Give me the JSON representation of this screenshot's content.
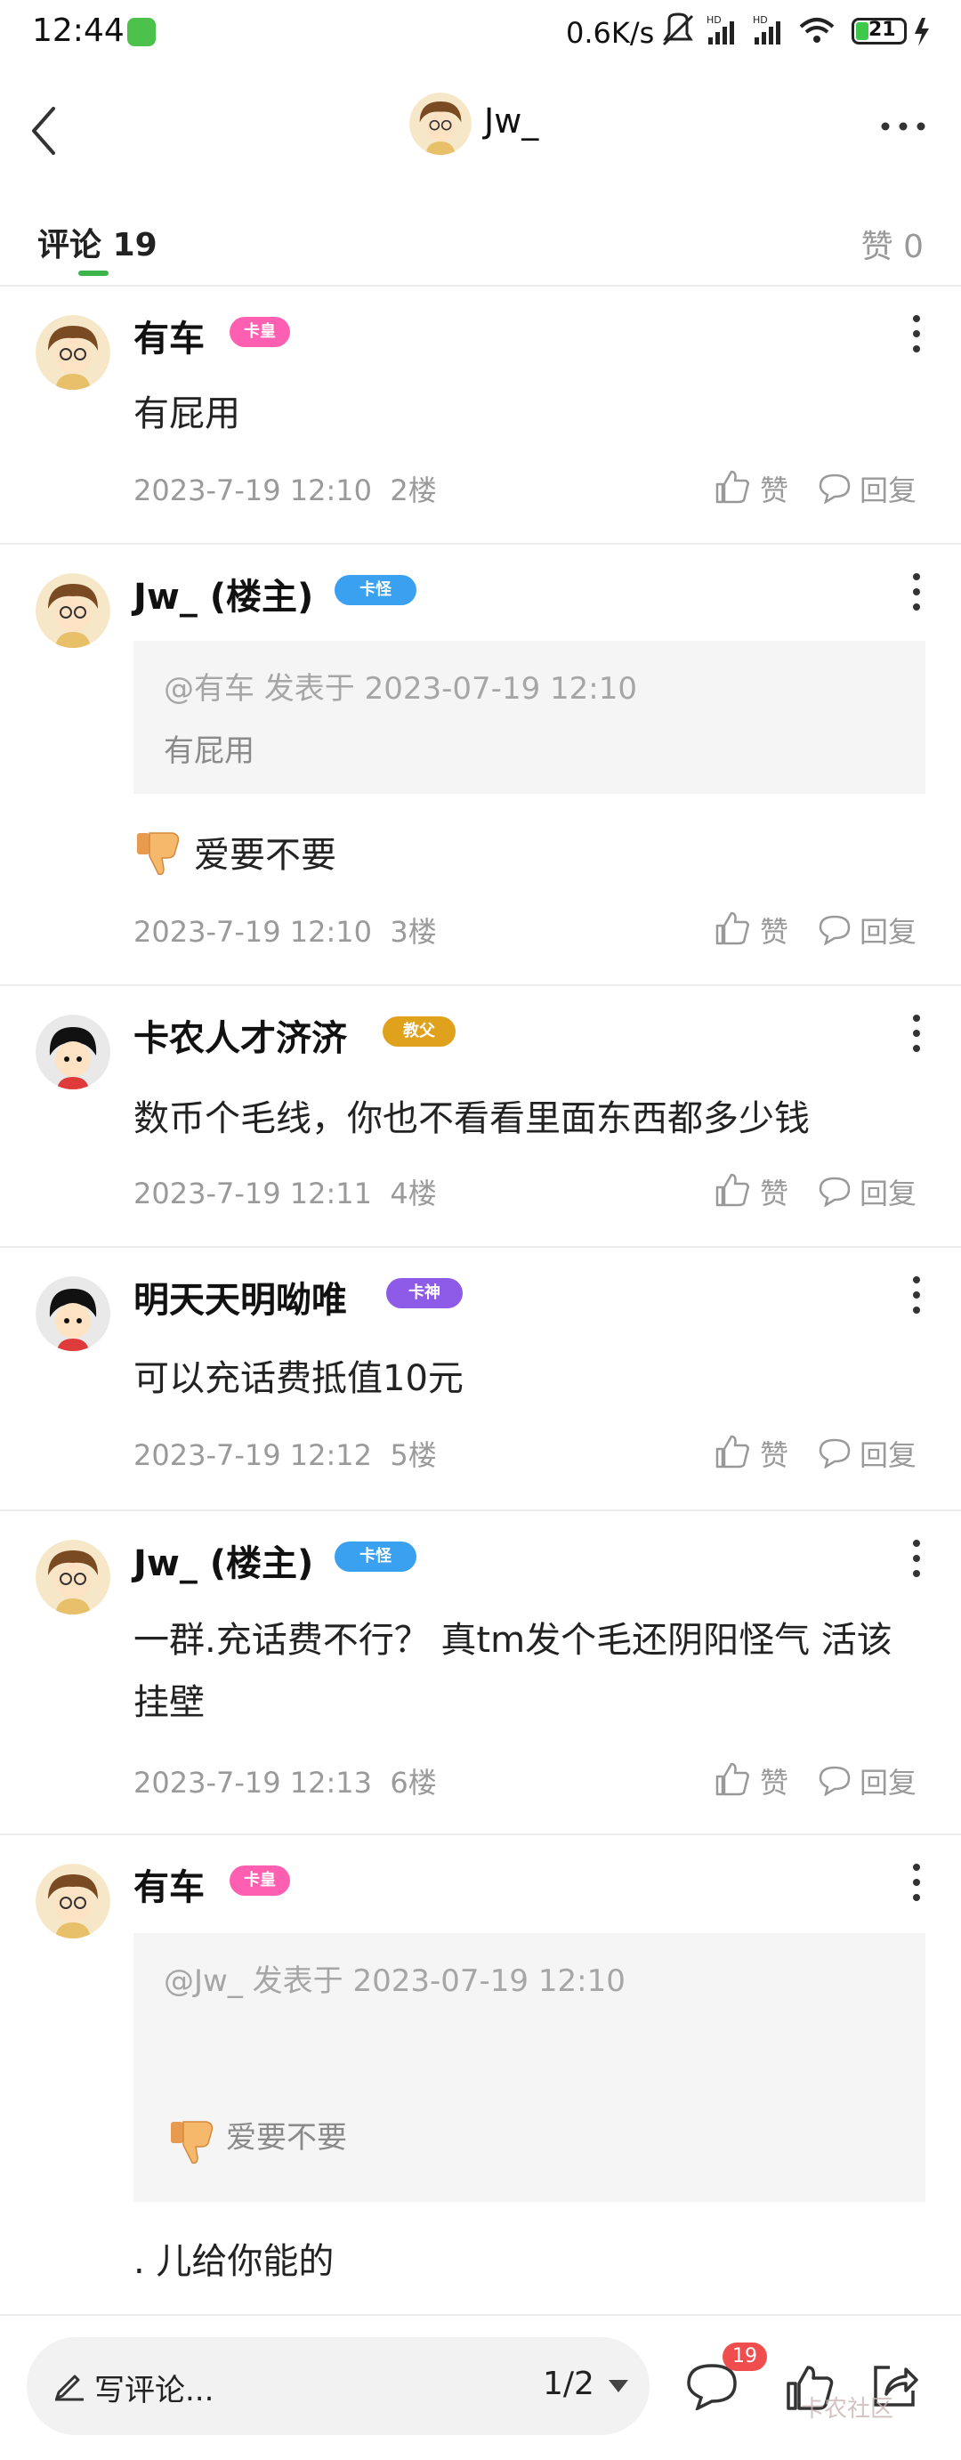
{
  "status_bar": {
    "time": "12:44",
    "speed": "0.6K/s",
    "battery": "21"
  },
  "header": {
    "title": "Jw_"
  },
  "tabs": {
    "comments_label": "评论",
    "comments_count": "19",
    "likes_label": "赞",
    "likes_count": "0"
  },
  "comments": [
    {
      "name": "有车",
      "badge": "卡皇",
      "badge_color": "#ff5fb0",
      "text": "有屁用",
      "time": "2023-7-19 12:10",
      "floor": "2楼"
    },
    {
      "name": "Jw_ (楼主)",
      "badge": "卡怪",
      "badge_color": "#3aa0f0",
      "quote_head": "@有车 发表于 2023-07-19 12:10",
      "quote_body": "有屁用",
      "text": "爱要不要",
      "time": "2023-7-19 12:10",
      "floor": "3楼"
    },
    {
      "name": "卡农人才济济",
      "badge": "教父",
      "badge_color": "#e0a21c",
      "text": "数币个毛线，你也不看看里面东西都多少钱",
      "time": "2023-7-19 12:11",
      "floor": "4楼"
    },
    {
      "name": "明天天明呦唯",
      "badge": "卡神",
      "badge_color": "#8e5be8",
      "text": "可以充话费抵值10元",
      "time": "2023-7-19 12:12",
      "floor": "5楼"
    },
    {
      "name": "Jw_ (楼主)",
      "badge": "卡怪",
      "badge_color": "#3aa0f0",
      "text": "一群.充话费不行？ 真tm发个毛还阴阳怪气 活该挂壁",
      "time": "2023-7-19 12:13",
      "floor": "6楼"
    },
    {
      "name": "有车",
      "badge": "卡皇",
      "badge_color": "#ff5fb0",
      "quote_head": "@Jw_ 发表于 2023-07-19 12:10",
      "quote_body": "爱要不要",
      "text": ". 儿给你能的"
    }
  ],
  "actions": {
    "like": "赞",
    "reply": "回复"
  },
  "bottom_bar": {
    "write_placeholder": "写评论...",
    "page": "1/2",
    "comment_count": "19",
    "watermark": "卡农社区"
  }
}
